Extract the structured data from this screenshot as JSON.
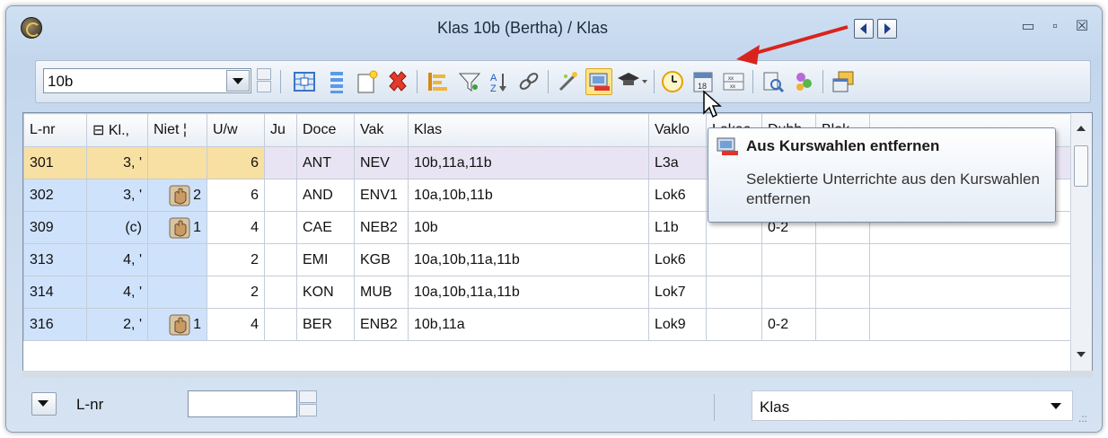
{
  "window": {
    "title": "Klas 10b (Bertha) / Klas",
    "controls": {
      "minimize": "▭",
      "maximize": "▫",
      "close": "☒"
    }
  },
  "toolbar": {
    "class_value": "10b"
  },
  "grid": {
    "headers": [
      "L-nr",
      "⊟ Kl.,",
      "Niet ¦",
      "U/w",
      "Ju",
      "Doce",
      "Vak",
      "Klas",
      "Vaklo",
      "Lokaa",
      "Dubb",
      "Blok"
    ],
    "rows": [
      {
        "lnr": "301",
        "kl": "3, '",
        "niet": "",
        "hand": false,
        "uw": "6",
        "ju": "",
        "docent": "ANT",
        "vak": "NEV",
        "klas": "10b,11a,11b",
        "vaklokaal": "L3a",
        "lokaal": "",
        "dubbel": "",
        "blok": ""
      },
      {
        "lnr": "302",
        "kl": "3, '",
        "niet": "2",
        "hand": true,
        "uw": "6",
        "ju": "",
        "docent": "AND",
        "vak": "ENV1",
        "klas": "10a,10b,11b",
        "vaklokaal": "Lok6",
        "lokaal": "",
        "dubbel": "",
        "blok": ""
      },
      {
        "lnr": "309",
        "kl": "(c)",
        "niet": "1",
        "hand": true,
        "uw": "4",
        "ju": "",
        "docent": "CAE",
        "vak": "NEB2",
        "klas": "10b",
        "vaklokaal": "L1b",
        "lokaal": "",
        "dubbel": "0-2",
        "blok": ""
      },
      {
        "lnr": "313",
        "kl": "4, '",
        "niet": "",
        "hand": false,
        "uw": "2",
        "ju": "",
        "docent": "EMI",
        "vak": "KGB",
        "klas": "10a,10b,11a,11b",
        "vaklokaal": "Lok6",
        "lokaal": "",
        "dubbel": "",
        "blok": ""
      },
      {
        "lnr": "314",
        "kl": "4, '",
        "niet": "",
        "hand": false,
        "uw": "2",
        "ju": "",
        "docent": "KON",
        "vak": "MUB",
        "klas": "10a,10b,11a,11b",
        "vaklokaal": "Lok7",
        "lokaal": "",
        "dubbel": "",
        "blok": ""
      },
      {
        "lnr": "316",
        "kl": "2, '",
        "niet": "1",
        "hand": true,
        "uw": "4",
        "ju": "",
        "docent": "BER",
        "vak": "ENB2",
        "klas": "10b,11a",
        "vaklokaal": "Lok9",
        "lokaal": "",
        "dubbel": "0-2",
        "blok": ""
      }
    ]
  },
  "tooltip": {
    "title": "Aus Kurswahlen entfernen",
    "description": "Selektierte Unterrichte aus den Kurswahlen entfernen"
  },
  "bottombar": {
    "field_label": "L-nr",
    "field_value": "",
    "view_value": "Klas",
    "grip": ".::"
  }
}
